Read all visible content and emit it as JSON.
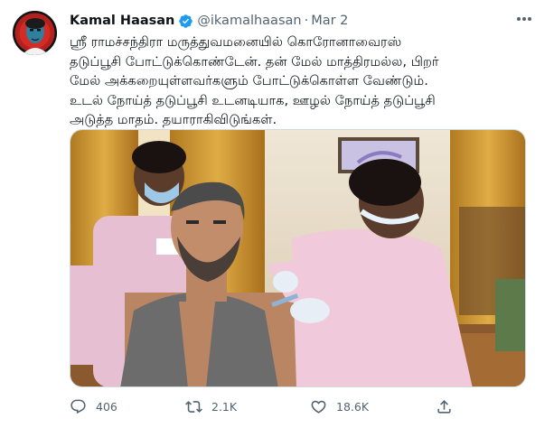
{
  "tweet": {
    "author": {
      "name": "Kamal Haasan",
      "handle": "@ikamalhaasan",
      "verified_icon": "verified-badge-icon",
      "avatar_icon": "profile-avatar"
    },
    "separator": "·",
    "date": "Mar 2",
    "more_icon": "more-options-icon",
    "text_lines": [
      "ஸ்ரீ ராமச்சந்திரா மருத்துவமனையில் கொரோனாவைரஸ்",
      "தடுப்பூசி போட்டுக்கொண்டேன். தன் மேல் மாத்திரமல்ல, பிறர்",
      "மேல் அக்கறையுள்ளவர்களும் போட்டுக்கொள்ள வேண்டும்.",
      "உடல் நோய்த் தடுப்பூசி உடனடியாக, ஊழல் நோய்த் தடுப்பூசி",
      "அடுத்த மாதம். தயாராகிவிடுங்கள்."
    ],
    "actions": {
      "reply": {
        "icon": "reply-icon",
        "count": "406"
      },
      "retweet": {
        "icon": "retweet-icon",
        "count": "2.1K"
      },
      "like": {
        "icon": "like-heart-icon",
        "count": "18.6K"
      },
      "share": {
        "icon": "share-icon"
      }
    }
  },
  "colors": {
    "text": "#0f1419",
    "secondary": "#536471",
    "verified": "#1d9bf0",
    "border": "#cfd9de"
  }
}
